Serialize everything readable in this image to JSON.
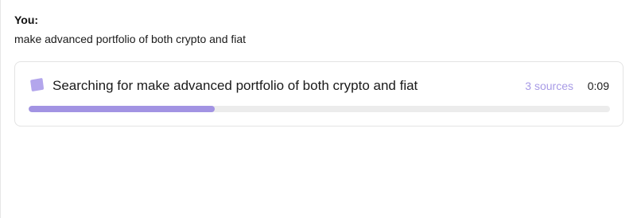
{
  "message": {
    "speaker": "You:",
    "text": "make advanced portfolio of both crypto and fiat"
  },
  "search_card": {
    "title": "Searching for make advanced portfolio of both crypto and fiat",
    "sources": "3 sources",
    "timer": "0:09",
    "progress": 0.32,
    "icon": "document-icon",
    "accent_color": "#a293e3",
    "sources_color": "#a89be6"
  }
}
